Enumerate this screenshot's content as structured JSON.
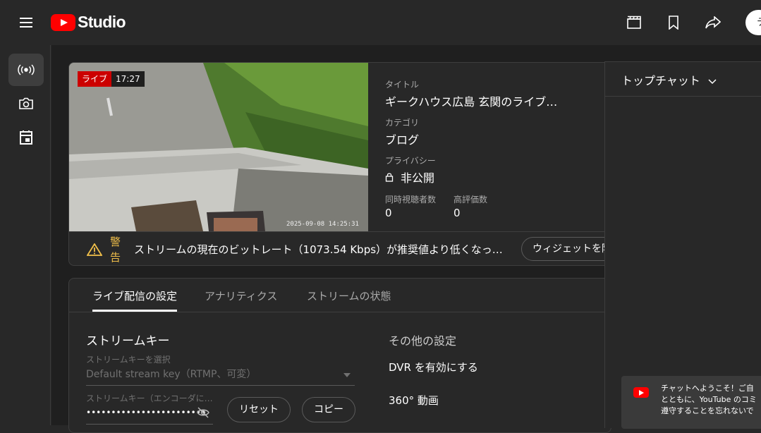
{
  "app": {
    "logo_text": "Studio",
    "avatar_letter": "テ"
  },
  "header_icons": [
    "clapperboard-icon",
    "bookmark-icon",
    "share-icon"
  ],
  "sidebar": {
    "items": [
      {
        "name": "live-icon",
        "active": true
      },
      {
        "name": "camera-icon",
        "active": false
      },
      {
        "name": "calendar-icon",
        "active": false
      }
    ]
  },
  "stream": {
    "live_badge": "ライブ",
    "elapsed": "17:27",
    "preview_timestamp": "2025-09-08 14:25:31",
    "title_label": "タイトル",
    "title": "ギークハウス広島 玄関のライブ…",
    "category_label": "カテゴリ",
    "category": "ブログ",
    "privacy_label": "プライバシー",
    "privacy": "非公開",
    "viewers_label": "同時視聴者数",
    "viewers": "0",
    "likes_label": "高評価数",
    "likes": "0"
  },
  "warning": {
    "label": "警告",
    "text": "ストリームの現在のビットレート（1073.54 Kbps）が推奨値より低くなっ…",
    "widget_button": "ウィジェットを隠"
  },
  "tabs": [
    "ライブ配信の設定",
    "アナリティクス",
    "ストリームの状態"
  ],
  "stream_key": {
    "section_title": "ストリームキー",
    "select_label": "ストリームキーを選択",
    "select_value": "Default stream key（RTMP、可変）",
    "key_label": "ストリームキー（エンコーダに…",
    "key_value": "••••••••••••••••••••••••",
    "reset_button": "リセット",
    "copy_button": "コピー"
  },
  "other_settings": {
    "section_title": "その他の設定",
    "dvr": "DVR を有効にする",
    "video_360": "360° 動画"
  },
  "chat": {
    "title": "トップチャット",
    "welcome": "チャットへようこそ！ご自\nとともに、YouTube のコミ\n遵守することを忘れないで"
  }
}
